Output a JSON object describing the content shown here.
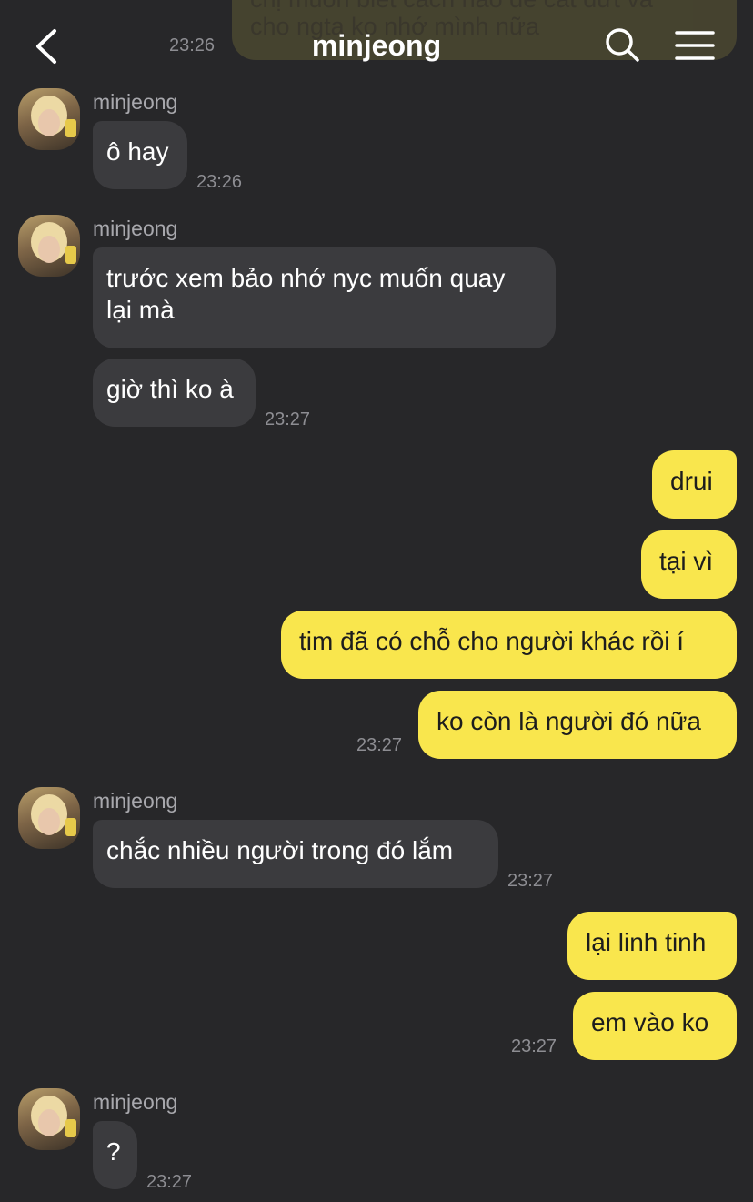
{
  "header": {
    "title": "minjeong",
    "back_icon": "chevron-left-icon",
    "search_icon": "search-icon",
    "menu_icon": "hamburger-menu-icon"
  },
  "partial_previous": {
    "line1": "chị muốn biết cách nào để cắt đứt và",
    "line2": "cho ngta ko nhớ mình nữa",
    "time": "23:26"
  },
  "messages": [
    {
      "sender": "minjeong",
      "text": "ô hay",
      "time": "23:26"
    },
    {
      "sender": "minjeong",
      "lines": [
        "trước xem bảo nhớ nyc muốn quay",
        "lại mà"
      ]
    },
    {
      "text": "giờ thì ko à",
      "time": "23:27"
    },
    {
      "text": "drui"
    },
    {
      "text": "tại vì"
    },
    {
      "text": "tim đã có chỗ cho người khác rồi í"
    },
    {
      "text": "ko còn là người đó nữa",
      "time": "23:27"
    },
    {
      "sender": "minjeong",
      "text": "chắc nhiều người trong đó lắm",
      "time": "23:27"
    },
    {
      "text": "lại linh tinh"
    },
    {
      "text": "em vào ko",
      "time": "23:27"
    },
    {
      "sender": "minjeong",
      "text": "?",
      "time": "23:27"
    }
  ],
  "colors": {
    "background": "#272729",
    "incoming_bubble": "#3b3b3e",
    "outgoing_bubble": "#f9e64d"
  }
}
